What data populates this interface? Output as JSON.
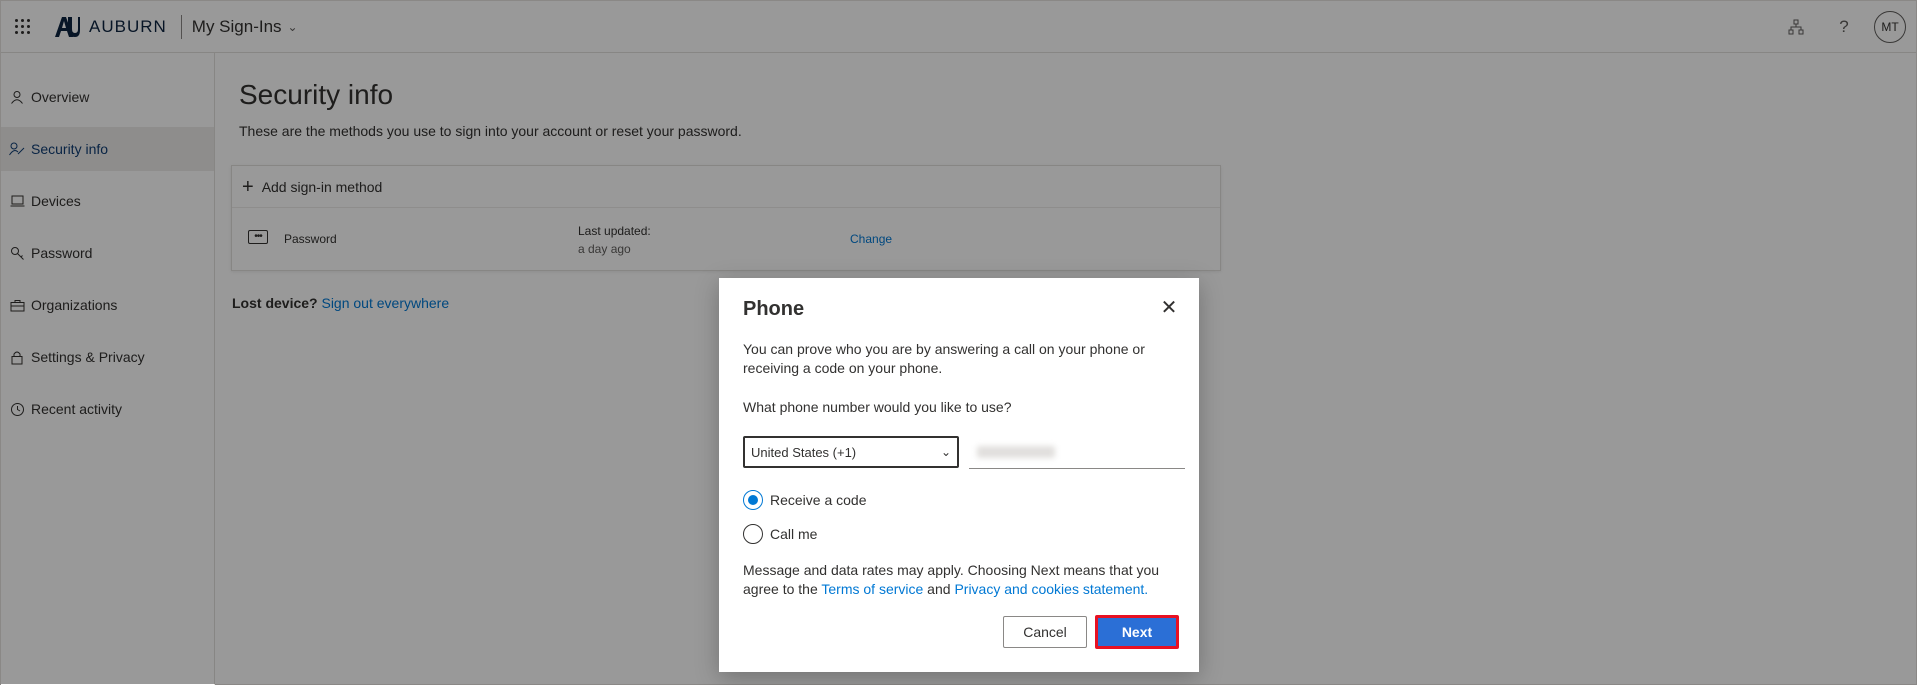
{
  "header": {
    "brand": "AUBURN",
    "app_title": "My Sign-Ins",
    "avatar_initials": "MT"
  },
  "sidebar": {
    "items": [
      {
        "label": "Overview",
        "icon": "person-icon"
      },
      {
        "label": "Security info",
        "icon": "key-person-icon",
        "active": true
      },
      {
        "label": "Devices",
        "icon": "laptop-icon"
      },
      {
        "label": "Password",
        "icon": "key-icon"
      },
      {
        "label": "Organizations",
        "icon": "briefcase-icon"
      },
      {
        "label": "Settings & Privacy",
        "icon": "lock-icon"
      },
      {
        "label": "Recent activity",
        "icon": "history-icon"
      }
    ]
  },
  "main": {
    "title": "Security info",
    "subtitle": "These are the methods you use to sign into your account or reset your password.",
    "add_method_label": "Add sign-in method",
    "methods": [
      {
        "name": "Password",
        "updated_label": "Last updated:",
        "updated_value": "a day ago",
        "action": "Change"
      }
    ],
    "lost_device_label": "Lost device?",
    "sign_out_link": "Sign out everywhere"
  },
  "dialog": {
    "title": "Phone",
    "description": "You can prove who you are by answering a call on your phone or receiving a code on your phone.",
    "question": "What phone number would you like to use?",
    "country_selected": "United States (+1)",
    "options": [
      {
        "label": "Receive a code",
        "checked": true
      },
      {
        "label": "Call me",
        "checked": false
      }
    ],
    "note_prefix": "Message and data rates may apply. Choosing Next means that you agree to the ",
    "terms_link": "Terms of service",
    "note_and": " and ",
    "privacy_link": "Privacy and cookies statement.",
    "cancel_label": "Cancel",
    "next_label": "Next"
  },
  "colors": {
    "accent": "#0078d4",
    "next_button": "#2b6fd6",
    "highlight_border": "#e81123"
  }
}
